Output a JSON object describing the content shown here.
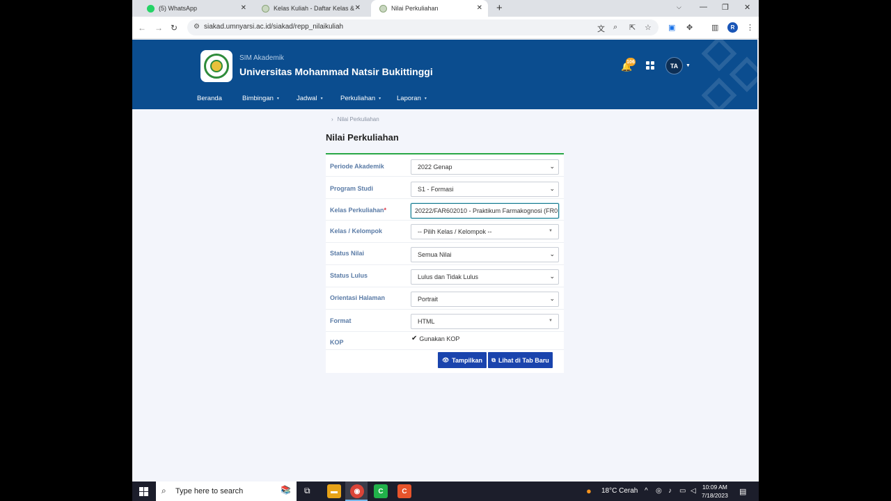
{
  "browser": {
    "tabs": [
      {
        "title": "(5) WhatsApp",
        "icon": "whatsapp-icon",
        "active": false
      },
      {
        "title": "Kelas Kuliah - Daftar Kelas & Ja",
        "icon": "university-icon",
        "active": false
      },
      {
        "title": "Nilai Perkuliahan",
        "icon": "university-icon",
        "active": true
      }
    ],
    "url": "siakad.umnyarsi.ac.id/siakad/repp_nilaikuliah",
    "profile_initial": "R"
  },
  "header": {
    "subtitle": "SIM Akademik",
    "title": "Universitas Mohammad Natsir Bukittinggi",
    "notification_count": "106",
    "user_initials": "TA",
    "nav": [
      {
        "label": "Beranda",
        "dropdown": false
      },
      {
        "label": "Bimbingan",
        "dropdown": true
      },
      {
        "label": "Jadwal",
        "dropdown": true
      },
      {
        "label": "Perkuliahan",
        "dropdown": true
      },
      {
        "label": "Laporan",
        "dropdown": true
      }
    ]
  },
  "page": {
    "breadcrumb": "Nilai Perkuliahan",
    "title": "Nilai Perkuliahan",
    "form": {
      "periode": {
        "label": "Periode Akademik",
        "value": "2022 Genap"
      },
      "prodi": {
        "label": "Program Studi",
        "value": "S1 - Formasi"
      },
      "kelas": {
        "label": "Kelas Perkuliahan",
        "required": "*",
        "value": "20222/FAR602010 - Praktikum Farmakognosi (FR0"
      },
      "kelompok": {
        "label": "Kelas / Kelompok",
        "value": "-- Pilih Kelas / Kelompok --"
      },
      "status_nilai": {
        "label": "Status Nilai",
        "value": "Semua Nilai"
      },
      "status_lulus": {
        "label": "Status Lulus",
        "value": "Lulus dan Tidak Lulus"
      },
      "orientasi": {
        "label": "Orientasi Halaman",
        "value": "Portrait"
      },
      "format": {
        "label": "Format",
        "value": "HTML"
      },
      "kop": {
        "label": "KOP",
        "checkbox_label": "Gunakan KOP",
        "checked": true
      }
    },
    "buttons": {
      "show": "Tampilkan",
      "new_tab": "Lihat di Tab Baru"
    }
  },
  "taskbar": {
    "search_placeholder": "Type here to search",
    "weather": "18°C  Cerah",
    "time": "10:09 AM",
    "date": "7/18/2023"
  },
  "colors": {
    "header": "#0b4d8f",
    "button": "#1a44ad",
    "label": "#5a7ba6",
    "card_accent": "#28a745"
  }
}
